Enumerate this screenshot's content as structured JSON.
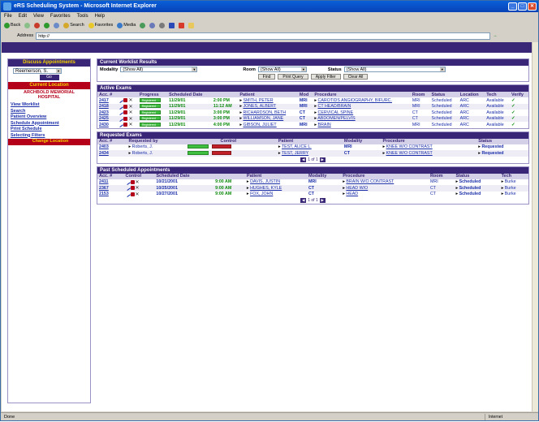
{
  "window": {
    "title": "eRS Scheduling System - Microsoft Internet Explorer"
  },
  "menu": [
    "File",
    "Edit",
    "View",
    "Favorites",
    "Tools",
    "Help"
  ],
  "toolbar": {
    "back": "Back",
    "search": "Search",
    "favorites": "Favorites",
    "media": "Media"
  },
  "address": {
    "label": "Address",
    "value": "http://"
  },
  "sidebar": {
    "head": "Discuss Appointments",
    "patient_select": "Reemerson, S.",
    "go_label": "Go",
    "location_head": "Current Location",
    "location_line1": "ARCHBOLD MEMORIAL",
    "location_line2": "HOSPITAL",
    "items": [
      {
        "label": "View Worklist",
        "active": false
      },
      {
        "label": "Search",
        "active": false
      },
      {
        "label": "Patient Overview",
        "active": false
      },
      {
        "label": "Schedule Appointment",
        "active": false
      },
      {
        "label": "Print Schedule",
        "active": false
      },
      {
        "label": "Selecting Filters",
        "active": false
      },
      {
        "label": "Change Location",
        "active": true
      }
    ]
  },
  "worklist": {
    "title": "Current Worklist Results",
    "filters": {
      "modality_label": "Modality",
      "modality_value": "(Show All)",
      "room_label": "Room",
      "room_value": "(Show All)",
      "status_label": "Status",
      "status_value": "(Show All)"
    },
    "buttons": [
      "Find",
      "Print Query",
      "Apply Filter",
      "Clear All"
    ]
  },
  "active_exams": {
    "title": "Active Exams",
    "columns": [
      "Acc. #",
      "",
      "Progress",
      "Scheduled Date",
      "",
      "Patient",
      "Mod",
      "Procedure",
      "Room",
      "Status",
      "Location",
      "Tech",
      "Verify"
    ],
    "rows": [
      {
        "acc": "2417",
        "progress": "Registered",
        "date": "11/29/01",
        "time": "2:00 PM",
        "patient": "SMITH, PETER",
        "mod": "MRI",
        "procedure": "CAROTIDS ANGIOGRAPHY, BIFURC.",
        "room": "MRI",
        "status": "Scheduled",
        "location": "ARC",
        "tech": "Available"
      },
      {
        "acc": "2418",
        "progress": "Registered",
        "date": "11/29/01",
        "time": "11:12 AM",
        "patient": "JONES, ALBERT",
        "mod": "MRI",
        "procedure": "CT HEAD/BRAIN",
        "room": "MRI",
        "status": "Scheduled",
        "location": "ARC",
        "tech": "Available"
      },
      {
        "acc": "2423",
        "progress": "Registered",
        "date": "11/29/01",
        "time": "3:00 PM",
        "patient": "RICHARDSON, BETH",
        "mod": "CT",
        "procedure": "CERVICAL SPINE",
        "room": "CT",
        "status": "Scheduled",
        "location": "ARC",
        "tech": "Available"
      },
      {
        "acc": "2425",
        "progress": "Registered",
        "date": "11/29/01",
        "time": "3:00 PM",
        "patient": "WILLIAMSON, JANE",
        "mod": "CT",
        "procedure": "ABDOMEN/PELVIS",
        "room": "CT",
        "status": "Scheduled",
        "location": "ARC",
        "tech": "Available"
      },
      {
        "acc": "2430",
        "progress": "Registered",
        "date": "11/29/01",
        "time": "4:00 PM",
        "patient": "GIBSON, JULIET",
        "mod": "MRI",
        "procedure": "BRAIN",
        "room": "MRI",
        "status": "Scheduled",
        "location": "ARC",
        "tech": "Available"
      }
    ]
  },
  "requested_exams": {
    "title": "Requested Exams",
    "columns": [
      "Acc. #",
      "Requested by",
      "Control",
      "",
      "Patient",
      "Modality",
      "Procedure",
      "Status"
    ],
    "rows": [
      {
        "acc": "2403",
        "requested_by": "Roberts, J.",
        "patient": "TEST, ALICE L.",
        "modality": "MRI",
        "procedure": "KNEE W/O CONTRAST",
        "status": "Requested"
      },
      {
        "acc": "2434",
        "requested_by": "Roberts, J.",
        "patient": "TEST, JERRY",
        "modality": "CT",
        "procedure": "KNEE W/O CONTRAST",
        "status": "Requested"
      }
    ]
  },
  "past_appointments": {
    "title": "Past Scheduled Appointments",
    "columns": [
      "Acc. #",
      "Control",
      "Scheduled Date",
      "",
      "Patient",
      "Modality",
      "Procedure",
      "Room",
      "Status",
      "Tech"
    ],
    "rows": [
      {
        "acc": "2411",
        "date": "10/21/2001",
        "time": "9:00 AM",
        "patient": "DAVIS, JUSTIN",
        "modality": "MRI",
        "procedure": "BRAIN W/O CONTRAST",
        "room": "MRI",
        "status": "Scheduled",
        "tech": "Burke"
      },
      {
        "acc": "2367",
        "date": "10/25/2001",
        "time": "9:00 AM",
        "patient": "HUGHES, KYLE",
        "modality": "CT",
        "procedure": "HEAD W/O",
        "room": "CT",
        "status": "Scheduled",
        "tech": "Burke"
      },
      {
        "acc": "2153",
        "date": "10/27/2001",
        "time": "9:00 AM",
        "patient": "FOX, JOHN",
        "modality": "CT",
        "procedure": "HEAD",
        "room": "CT",
        "status": "Scheduled",
        "tech": "Burke"
      }
    ]
  },
  "pager": {
    "text": "1 of 1"
  },
  "statusbar": {
    "left": "Done",
    "zone": "Internet"
  },
  "colors": {
    "brand": "#3a2676",
    "accent": "#b5001a",
    "highlight": "#f7d300"
  }
}
